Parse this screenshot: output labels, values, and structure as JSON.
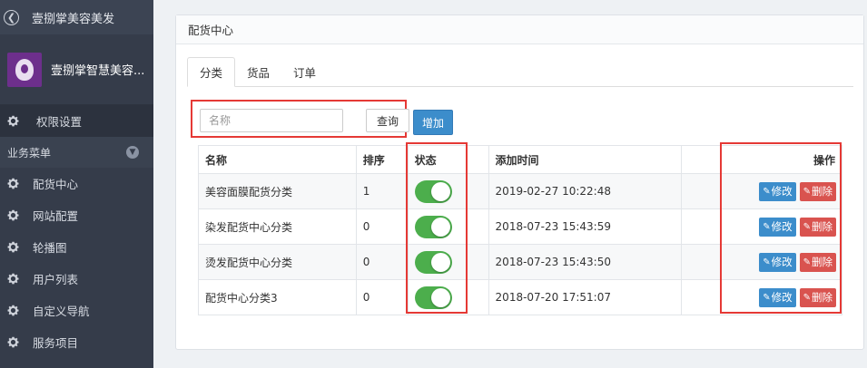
{
  "sidebar": {
    "app_title": "壹捌掌美容美发",
    "user_name": "壹捌掌智慧美容...",
    "perm_label": "权限设置",
    "group_label": "业务菜单",
    "items": [
      {
        "label": "配货中心"
      },
      {
        "label": "网站配置"
      },
      {
        "label": "轮播图"
      },
      {
        "label": "用户列表"
      },
      {
        "label": "自定义导航"
      },
      {
        "label": "服务项目"
      }
    ]
  },
  "panel": {
    "title": "配货中心",
    "tabs": [
      {
        "label": "分类"
      },
      {
        "label": "货品"
      },
      {
        "label": "订单"
      }
    ],
    "search_placeholder": "名称",
    "query_label": "查询",
    "add_label": "增加"
  },
  "table": {
    "headers": {
      "name": "名称",
      "order": "排序",
      "status": "状态",
      "time": "添加时间",
      "ops": "操作"
    },
    "rows": [
      {
        "name": "美容面膜配货分类",
        "order": "1",
        "status": "on",
        "time": "2019-02-27 10:22:48"
      },
      {
        "name": "染发配货中心分类",
        "order": "0",
        "status": "on",
        "time": "2018-07-23 15:43:59"
      },
      {
        "name": "烫发配货中心分类",
        "order": "0",
        "status": "on",
        "time": "2018-07-23 15:43:50"
      },
      {
        "name": "配货中心分类3",
        "order": "0",
        "status": "on",
        "time": "2018-07-20 17:51:07"
      }
    ],
    "edit_label": "修改",
    "delete_label": "删除"
  },
  "colors": {
    "sidebar_bg": "#353c4a",
    "primary": "#3c8dcb",
    "danger": "#d9534f",
    "toggle_on": "#4cae4c",
    "highlight": "#e53935"
  },
  "icons": [
    "back-icon",
    "gear-icon",
    "chevron-down-icon",
    "edit-icon",
    "delete-icon"
  ]
}
